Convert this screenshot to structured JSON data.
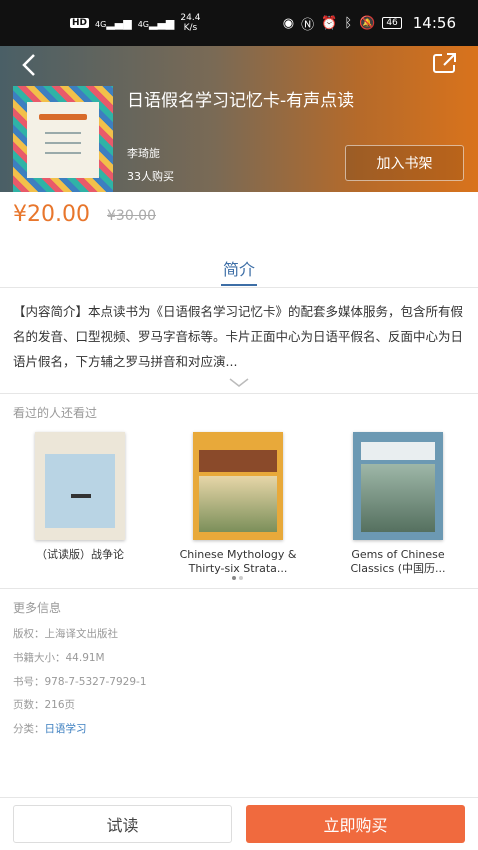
{
  "status_bar": {
    "hd": "HD",
    "network1": "4G",
    "network2": "4G",
    "speed_value": "24.4",
    "speed_unit": "K/s",
    "battery": "46",
    "time": "14:56"
  },
  "header": {
    "book_title": "日语假名学习记忆卡-有声点读",
    "author": "李琦旎",
    "buyers": "33人购买",
    "shelf_button": "加入书架"
  },
  "price": {
    "current": "¥20.00",
    "original": "¥30.00"
  },
  "tabs": [
    {
      "label": "简介",
      "active": true
    }
  ],
  "intro": {
    "text": "【内容简介】本点读书为《日语假名学习记忆卡》的配套多媒体服务，包含所有假名的发音、口型视频、罗马字音标等。卡片正面中心为日语平假名、反面中心为日语片假名，下方辅之罗马拼音和对应演..."
  },
  "also_viewed": {
    "title": "看过的人还看过",
    "items": [
      {
        "label": "（试读版）战争论"
      },
      {
        "label": "Chinese Mythology & Thirty-six Strata..."
      },
      {
        "label": "Gems of Chinese Classics (中国历..."
      }
    ]
  },
  "more_info": {
    "title": "更多信息",
    "rows": [
      {
        "key": "版权：",
        "value": "上海译文出版社"
      },
      {
        "key": "书籍大小：",
        "value": "44.91M"
      },
      {
        "key": "书号：",
        "value": "978-7-5327-7929-1"
      },
      {
        "key": "页数：",
        "value": "216页"
      },
      {
        "key": "分类：",
        "value": "日语学习"
      }
    ]
  },
  "bottom": {
    "try_read": "试读",
    "buy_now": "立即购买"
  },
  "colors": {
    "accent": "#f06a3e",
    "price": "#e8762c",
    "tab": "#3d6ea6",
    "link": "#3d7fc0"
  }
}
